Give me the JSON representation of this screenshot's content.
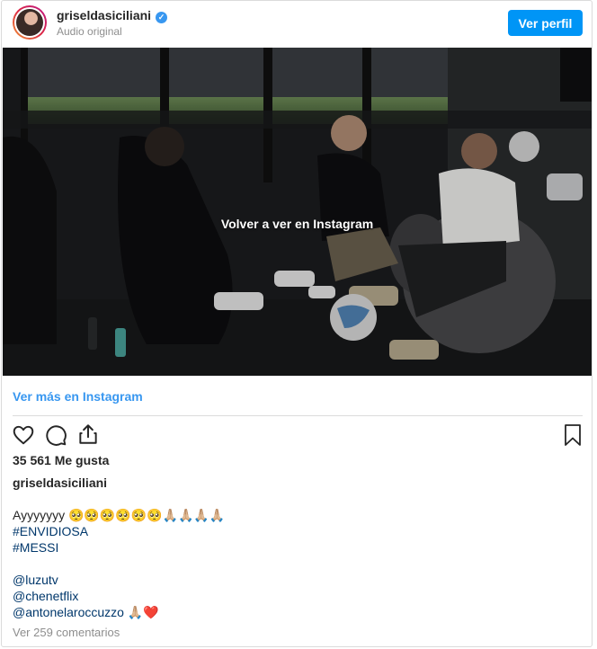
{
  "header": {
    "username": "griseldasiciliani",
    "verified_mark": "✓",
    "subtitle": "Audio original",
    "view_profile_label": "Ver perfil"
  },
  "video": {
    "overlay_text": "Volver a ver en Instagram"
  },
  "more_link": "Ver más en Instagram",
  "actions": {
    "like_icon": "heart-icon",
    "comment_icon": "comment-icon",
    "share_icon": "share-icon",
    "save_icon": "bookmark-icon"
  },
  "likes_text": "35 561 Me gusta",
  "owner": "griseldasiciliani",
  "caption": {
    "text_line": "Ayyyyyyy 🥺🥺🥺🥺🥺🥺🙏🏼🙏🏼🙏🏼🙏🏼",
    "hashtags": [
      "#ENVIDIOSA",
      "#MESSI"
    ],
    "mentions": [
      "@luzutv",
      "@chenetflix"
    ],
    "last_mention": "@antonelaroccuzzo",
    "last_emoji": "🙏🏼❤️"
  },
  "comments_link": "Ver 259 comentarios",
  "colors": {
    "accent": "#0095f6",
    "link": "#3897f0",
    "hashtag": "#00376b",
    "muted": "#8e8e8e"
  }
}
